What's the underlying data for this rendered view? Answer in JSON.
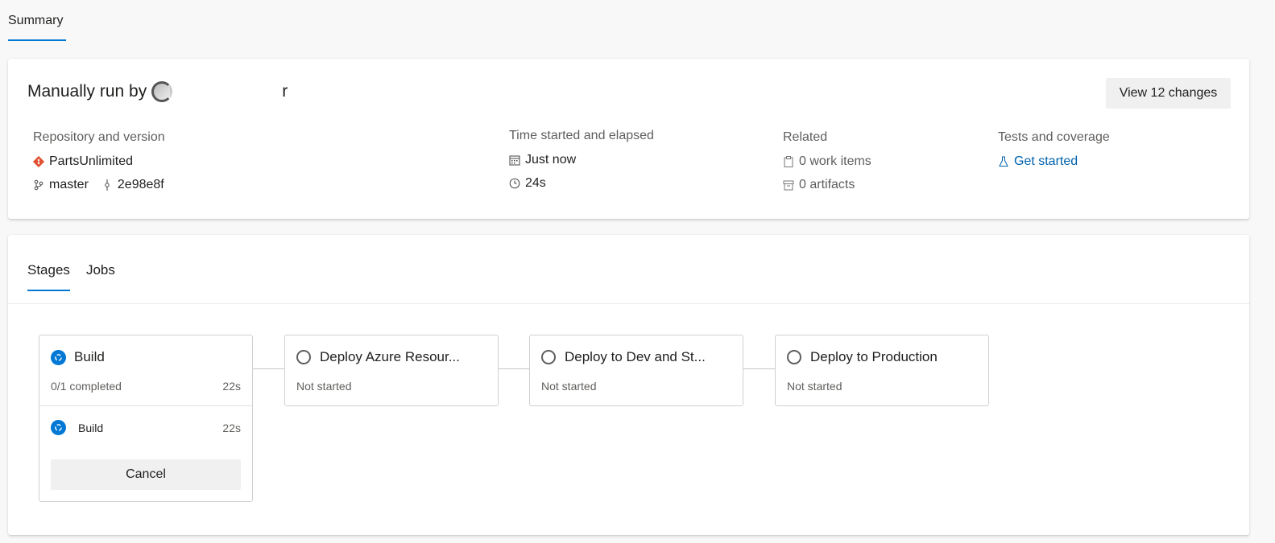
{
  "top_tabs": {
    "summary": "Summary"
  },
  "run": {
    "title_prefix": "Manually run by",
    "user_suffix": "r",
    "view_changes": "View 12 changes"
  },
  "repo": {
    "label": "Repository and version",
    "name": "PartsUnlimited",
    "branch": "master",
    "commit": "2e98e8f"
  },
  "time": {
    "label": "Time started and elapsed",
    "started": "Just now",
    "elapsed": "24s"
  },
  "related": {
    "label": "Related",
    "work_items": "0 work items",
    "artifacts": "0 artifacts"
  },
  "tests": {
    "label": "Tests and coverage",
    "link": "Get started"
  },
  "stage_tabs": {
    "stages": "Stages",
    "jobs": "Jobs"
  },
  "stages": [
    {
      "name": "Build",
      "status": "0/1 completed",
      "duration": "22s",
      "state": "running",
      "job": {
        "name": "Build",
        "duration": "22s"
      },
      "cancel": "Cancel"
    },
    {
      "name": "Deploy Azure Resour...",
      "status": "Not started",
      "state": "not-started"
    },
    {
      "name": "Deploy to Dev and St...",
      "status": "Not started",
      "state": "not-started"
    },
    {
      "name": "Deploy to Production",
      "status": "Not started",
      "state": "not-started"
    }
  ],
  "colors": {
    "accent": "#0078d4",
    "link": "#0062ad",
    "git": "#e05132"
  }
}
